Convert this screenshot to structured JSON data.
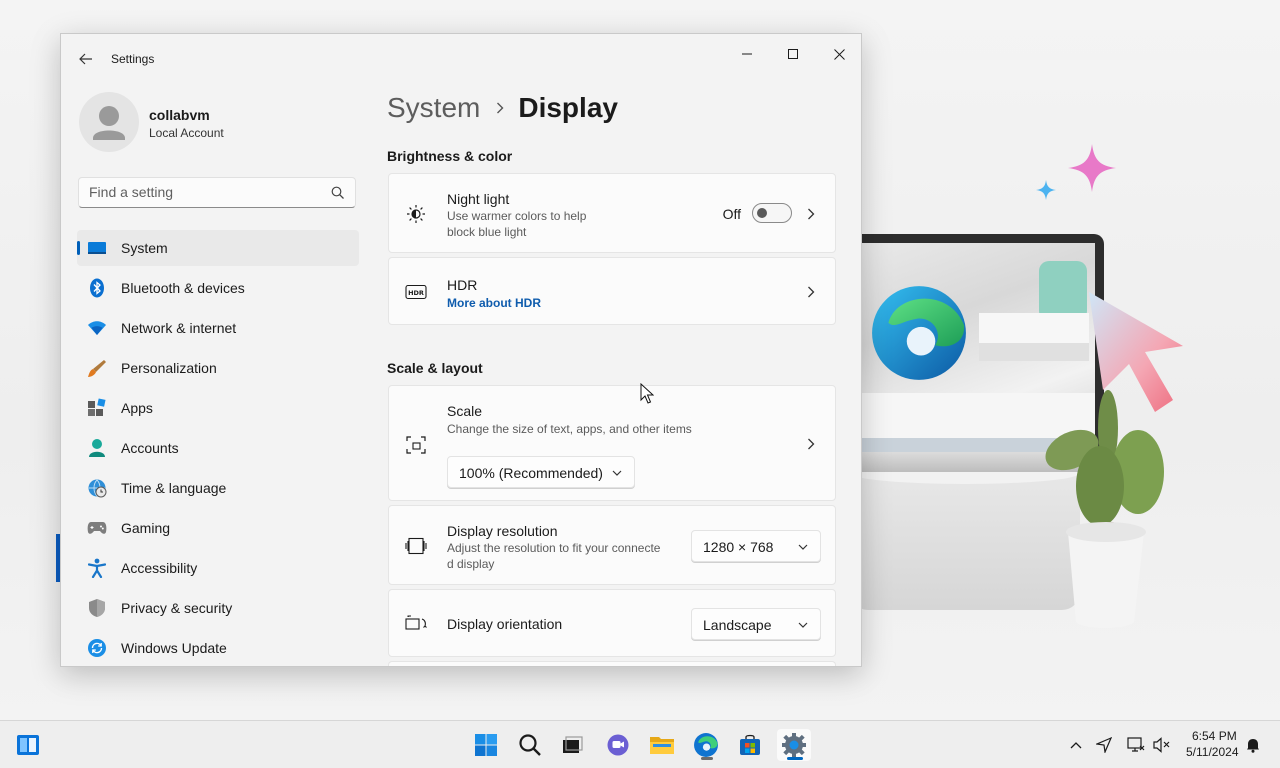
{
  "window": {
    "title": "Settings",
    "controls": {
      "minimize": "minimize",
      "maximize": "maximize",
      "close": "close"
    }
  },
  "profile": {
    "name": "collabvm",
    "account_type": "Local Account"
  },
  "search": {
    "placeholder": "Find a setting"
  },
  "sidebar": {
    "items": [
      {
        "label": "System",
        "icon": "monitor-icon",
        "active": true
      },
      {
        "label": "Bluetooth & devices",
        "icon": "bluetooth-icon"
      },
      {
        "label": "Network & internet",
        "icon": "wifi-icon"
      },
      {
        "label": "Personalization",
        "icon": "brush-icon"
      },
      {
        "label": "Apps",
        "icon": "apps-icon"
      },
      {
        "label": "Accounts",
        "icon": "person-icon"
      },
      {
        "label": "Time & language",
        "icon": "globe-clock-icon"
      },
      {
        "label": "Gaming",
        "icon": "gamepad-icon"
      },
      {
        "label": "Accessibility",
        "icon": "accessibility-icon"
      },
      {
        "label": "Privacy & security",
        "icon": "shield-icon"
      },
      {
        "label": "Windows Update",
        "icon": "update-icon"
      }
    ]
  },
  "breadcrumb": {
    "parent": "System",
    "current": "Display"
  },
  "sections": {
    "brightness": "Brightness & color",
    "scale_layout": "Scale & layout"
  },
  "night_light": {
    "title": "Night light",
    "description_line1": "Use warmer colors to help",
    "description_line2": "block blue light",
    "state_label": "Off",
    "state": false
  },
  "hdr": {
    "title": "HDR",
    "link": "More about HDR"
  },
  "scale": {
    "title": "Scale",
    "description": "Change the size of text, apps, and other items",
    "value": "100% (Recommended)"
  },
  "resolution": {
    "title": "Display resolution",
    "description_line1": "Adjust the resolution to fit your connecte",
    "description_line2": "d display",
    "value": "1280 × 768"
  },
  "orientation": {
    "title": "Display orientation",
    "value": "Landscape"
  },
  "taskbar": {
    "clock_time": "6:54 PM",
    "clock_date": "5/11/2024"
  },
  "colors": {
    "accent": "#005fb8",
    "link": "#0f5cad"
  }
}
